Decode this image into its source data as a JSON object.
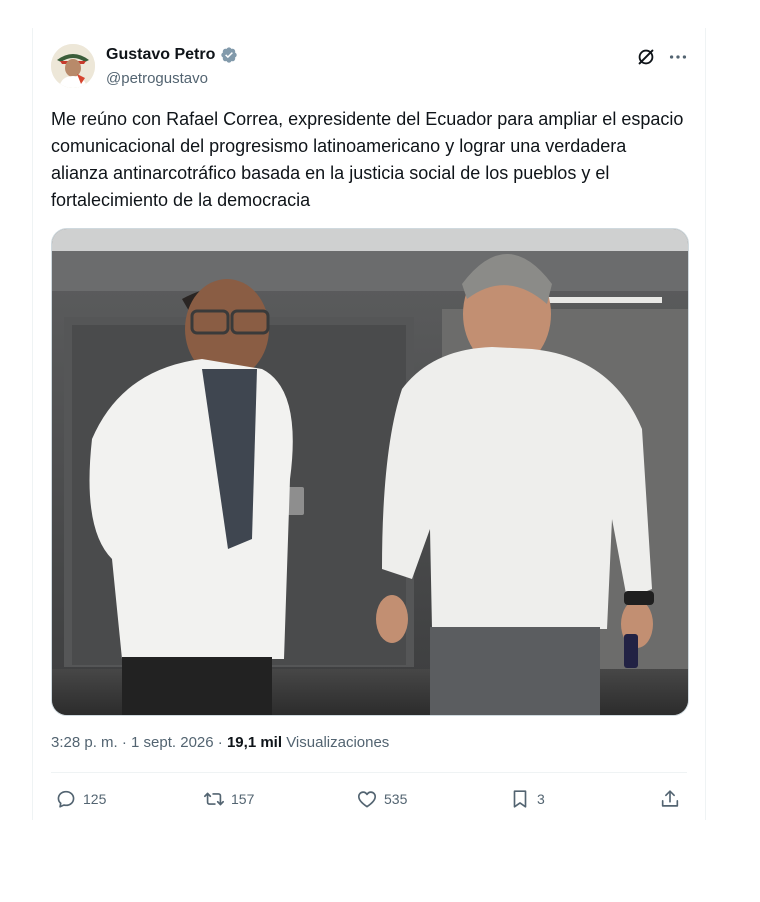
{
  "author": {
    "name": "Gustavo Petro",
    "handle": "@petrogustavo"
  },
  "tweet": {
    "text": "Me reúno con  Rafael Correa, expresidente del Ecuador para ampliar el espacio comunicacional del progresismo latinoamericano y lograr una verdadera alianza antinarcotráfico basada en la justicia social de los pueblos y el fortalecimiento de la democracia"
  },
  "meta": {
    "time": "3:28 p. m.",
    "separator": "·",
    "date": "1 sept. 2026",
    "views_count": "19,1 mil",
    "views_label": "Visualizaciones"
  },
  "actions": {
    "replies": "125",
    "retweets": "157",
    "likes": "535",
    "bookmarks": "3"
  },
  "colors": {
    "verified": "#829aab",
    "secondary_text": "#536471",
    "divider": "#eff3f4"
  },
  "icons": [
    "verified-badge-icon",
    "grok-icon",
    "more-icon",
    "reply-icon",
    "retweet-icon",
    "like-icon",
    "bookmark-icon",
    "share-icon"
  ]
}
